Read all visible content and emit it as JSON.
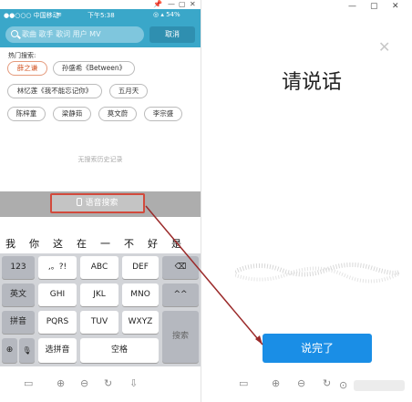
{
  "left_window": {
    "controls": [
      "📌",
      "—",
      "▢",
      "✕"
    ],
    "status": {
      "carrier": "●●○○○ 中国移动",
      "wifi": "≋",
      "time": "下午5:38",
      "right": "◎ ▴ 54%"
    },
    "search": {
      "placeholder": "歌曲 歌手 歌词 用户 MV"
    },
    "cancel_label": "取消",
    "hot_title": "热门搜索:",
    "tags": [
      "薛之谦",
      "孙盛希《Between》",
      "林忆莲《我不能忘记你》",
      "五月天",
      "陈梓童",
      "梁静茹",
      "莫文蔚",
      "李宗盛"
    ],
    "no_history": "无搜索历史记录",
    "voice_search_label": "语音搜索",
    "candidates": [
      "我",
      "你",
      "这",
      "在",
      "一",
      "不",
      "好",
      "是"
    ],
    "keys": {
      "k123": "123",
      "punct": ",。?!",
      "abc": "ABC",
      "def": "DEF",
      "del": "⌫",
      "en": "英文",
      "ghi": "GHI",
      "jkl": "JKL",
      "mno": "MNO",
      "face": "^^",
      "pinyin": "拼音",
      "pqrs": "PQRS",
      "tuv": "TUV",
      "wxyz": "WXYZ",
      "globe": "⊕",
      "mic": "🎙",
      "select": "选拼音",
      "space": "空格",
      "search": "搜索"
    },
    "bottom_icons": [
      "▭",
      "⊕",
      "⊖",
      "↻",
      "⇩"
    ]
  },
  "right_window": {
    "controls": [
      "—",
      "▢",
      "✕"
    ],
    "close": "✕",
    "prompt": "请说话",
    "done_label": "说完了",
    "bottom_icons": [
      "▭",
      "⊕",
      "⊖",
      "↻",
      "⇩"
    ],
    "watermark_icon": "⊙"
  },
  "colors": {
    "header": "#3aa7c9",
    "highlight_border": "#d24a3c",
    "done_button": "#1a8ee6",
    "arrow": "#9b2a2a"
  }
}
